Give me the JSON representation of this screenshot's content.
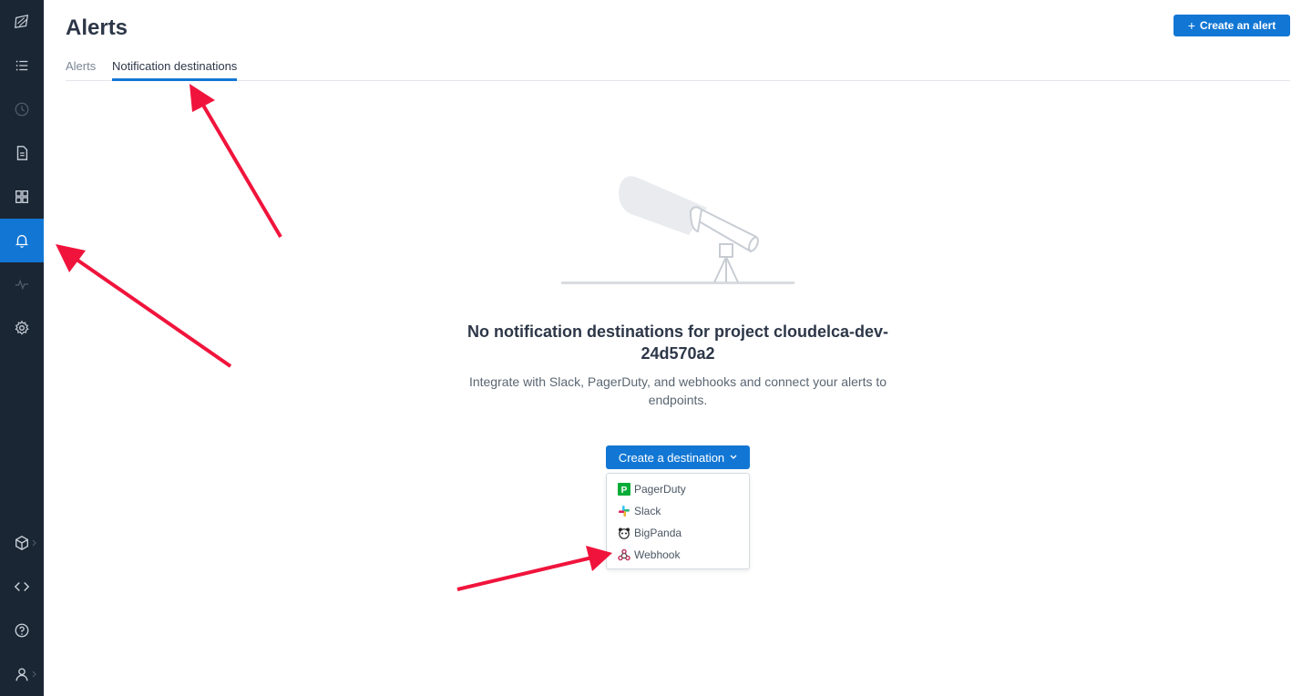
{
  "page": {
    "title": "Alerts",
    "create_alert_label": "Create an alert"
  },
  "tabs": [
    {
      "label": "Alerts",
      "active": false
    },
    {
      "label": "Notification destinations",
      "active": true
    }
  ],
  "sidebar": {
    "items": [
      {
        "icon": "logo-icon"
      },
      {
        "icon": "list-icon"
      },
      {
        "icon": "clock-icon"
      },
      {
        "icon": "document-icon"
      },
      {
        "icon": "grid-icon"
      },
      {
        "icon": "bell-icon",
        "active": true
      },
      {
        "icon": "pulse-icon"
      },
      {
        "icon": "gear-icon"
      },
      {
        "icon": "package-icon"
      },
      {
        "icon": "code-icon"
      },
      {
        "icon": "help-icon"
      },
      {
        "icon": "user-icon"
      }
    ]
  },
  "empty_state": {
    "title": "No notification destinations for project cloudelca-dev-24d570a2",
    "description": "Integrate with Slack, PagerDuty, and webhooks and connect your alerts to endpoints."
  },
  "destination_menu": {
    "button_label": "Create a destination",
    "options": [
      {
        "label": "PagerDuty",
        "icon": "pagerduty-icon"
      },
      {
        "label": "Slack",
        "icon": "slack-icon"
      },
      {
        "label": "BigPanda",
        "icon": "bigpanda-icon"
      },
      {
        "label": "Webhook",
        "icon": "webhook-icon"
      }
    ]
  },
  "colors": {
    "sidebar_bg": "#1b2634",
    "accent": "#1277d4",
    "annotation_arrow": "#f0143c"
  }
}
